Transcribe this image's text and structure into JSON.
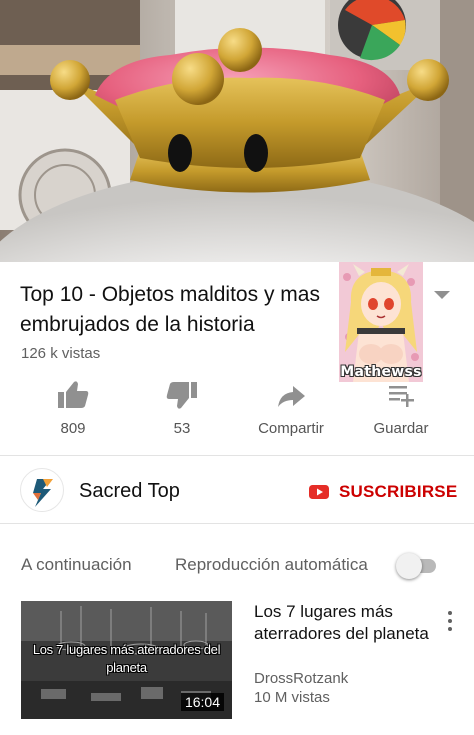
{
  "video": {
    "title": "Top 10 - Objetos malditos y mas embrujados de la historia",
    "views": "126 k vistas"
  },
  "overlay": {
    "watermark": "Mathewss"
  },
  "actions": {
    "like_count": "809",
    "dislike_count": "53",
    "share_label": "Compartir",
    "save_label": "Guardar"
  },
  "channel": {
    "name": "Sacred Top",
    "subscribe_label": "SUSCRIBIRSE"
  },
  "up_next": {
    "label": "A continuación",
    "autoplay_label": "Reproducción automática",
    "autoplay_on": false
  },
  "recommended": [
    {
      "title": "Los 7 lugares más aterradores del planeta",
      "thumb_title": "Los 7 lugares más aterradores del planeta",
      "duration": "16:04",
      "channel": "DrossRotzank",
      "views": "10 M vistas"
    }
  ],
  "colors": {
    "subscribe_red": "#cc0000",
    "secondary_text": "#606060",
    "icon_gray": "#909090",
    "divider": "#e3e3e3"
  },
  "icons": {
    "like": "thumbs-up-icon",
    "dislike": "thumbs-down-icon",
    "share": "share-arrow-icon",
    "save": "playlist-add-icon",
    "expand": "chevron-down-icon",
    "menu": "more-vert-icon"
  }
}
